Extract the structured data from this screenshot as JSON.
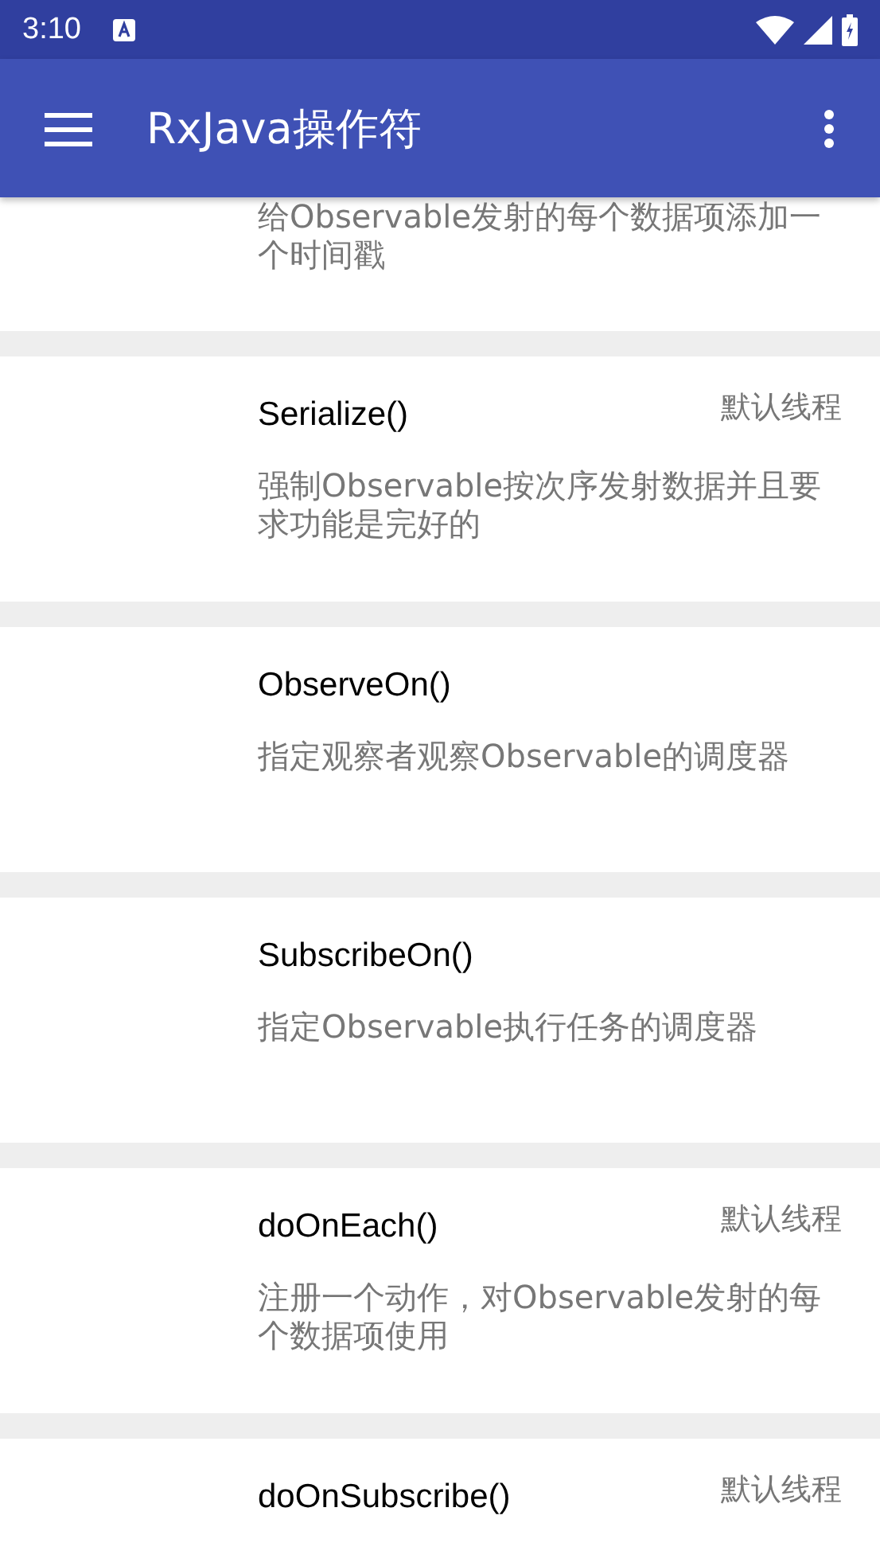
{
  "status_bar": {
    "time": "3:10"
  },
  "toolbar": {
    "title": "RxJava操作符"
  },
  "items": [
    {
      "description": "给Observable发射的每个数据项添加一个时间戳"
    },
    {
      "name": "Serialize()",
      "thread": "默认线程",
      "description": "强制Observable按次序发射数据并且要求功能是完好的"
    },
    {
      "name": "ObserveOn()",
      "description": "指定观察者观察Observable的调度器"
    },
    {
      "name": "SubscribeOn()",
      "description": "指定Observable执行任务的调度器"
    },
    {
      "name": "doOnEach()",
      "thread": "默认线程",
      "description": "注册一个动作，对Observable发射的每个数据项使用"
    },
    {
      "name": "doOnSubscribe()",
      "thread": "默认线程"
    }
  ]
}
